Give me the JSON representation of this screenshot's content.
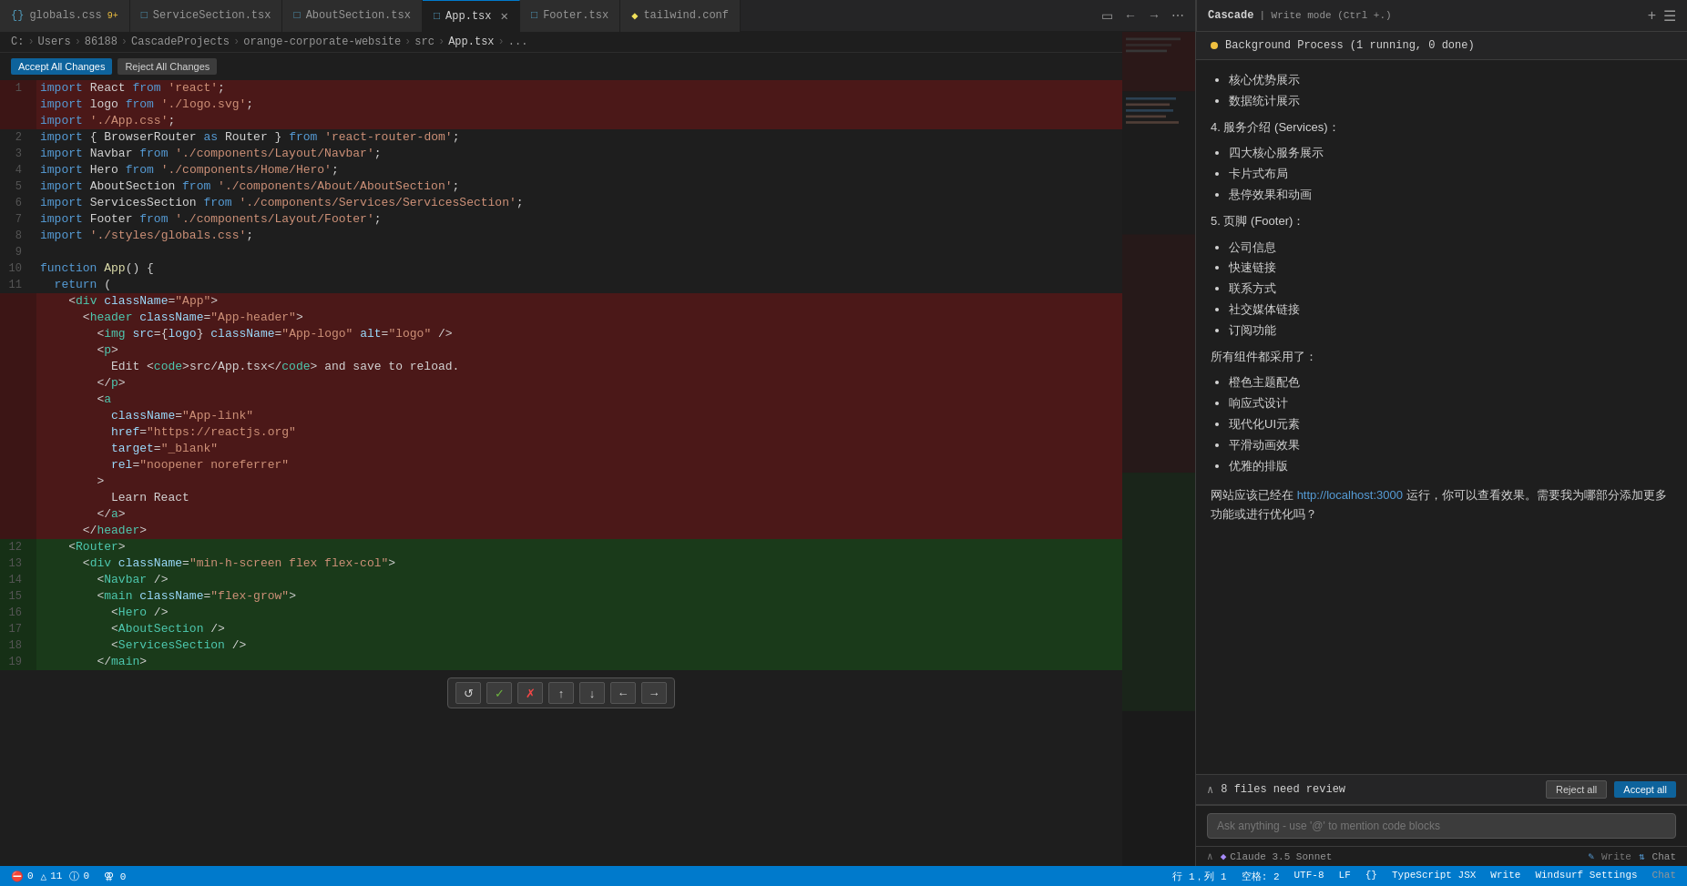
{
  "tabs": [
    {
      "id": "globals",
      "icon": "css",
      "label": "globals.css",
      "badge": "9+",
      "active": false
    },
    {
      "id": "services",
      "icon": "tsx",
      "label": "ServiceSection.tsx",
      "active": false
    },
    {
      "id": "about",
      "icon": "tsx",
      "label": "AboutSection.tsx",
      "active": false
    },
    {
      "id": "app",
      "icon": "tsx",
      "label": "App.tsx",
      "active": true
    },
    {
      "id": "footer",
      "icon": "tsx",
      "label": "Footer.tsx",
      "active": false
    },
    {
      "id": "tailwind",
      "icon": "config",
      "label": "tailwind.conf",
      "active": false
    }
  ],
  "breadcrumb": {
    "parts": [
      "C:",
      "Users",
      "86188",
      "CascadeProjects",
      "orange-corporate-website",
      "src",
      "App.tsx",
      "..."
    ]
  },
  "action_buttons": {
    "accept_all": "Accept All Changes",
    "reject_all": "Reject All Changes"
  },
  "cascade": {
    "title": "Cascade",
    "mode": "Write mode",
    "shortcut": "(Ctrl +.)",
    "background_process": "Background Process (1 running, 0 done)",
    "sections": [
      {
        "heading": "核心优势展示",
        "items": [
          "核心优势展示",
          "数据统计展示"
        ]
      },
      {
        "heading": "4. 服务介绍 (Services)：",
        "items": [
          "四大核心服务展示",
          "卡片式布局",
          "悬停效果和动画"
        ]
      },
      {
        "heading": "5. 页脚 (Footer)：",
        "items": [
          "公司信息",
          "快速链接",
          "联系方式",
          "社交媒体链接",
          "订阅功能"
        ]
      },
      {
        "heading": "所有组件都采用了：",
        "items": [
          "橙色主题配色",
          "响应式设计",
          "现代化UI元素",
          "平滑动画效果",
          "优雅的排版"
        ]
      }
    ],
    "closing_text": "网站应该已经在 http://localhost:3000 运行，你可以查看效果。需要我为哪部分添加更多功能或进行优化吗？",
    "localhost_url": "http://localhost:3000",
    "files_review": "8 files need review",
    "reject_label": "Reject all",
    "accept_label": "Accept all",
    "chat_placeholder": "Ask anything - use '@' to mention code blocks",
    "model_name": "Claude 3.5 Sonnet",
    "write_label": "Write",
    "chat_label": "Chat"
  },
  "status_bar": {
    "errors": "0",
    "warnings": "0",
    "count": "11",
    "info": "0",
    "line": "行 1，列 1",
    "spaces": "空格: 2",
    "encoding": "UTF-8",
    "line_ending": "LF",
    "indent": "{}",
    "file_type": "TypeScript JSX",
    "settings": "Windsurf Settings"
  },
  "diff_toolbar": {
    "buttons": [
      "↺",
      "✓",
      "✗",
      "↑",
      "↓",
      "←",
      "→"
    ]
  }
}
